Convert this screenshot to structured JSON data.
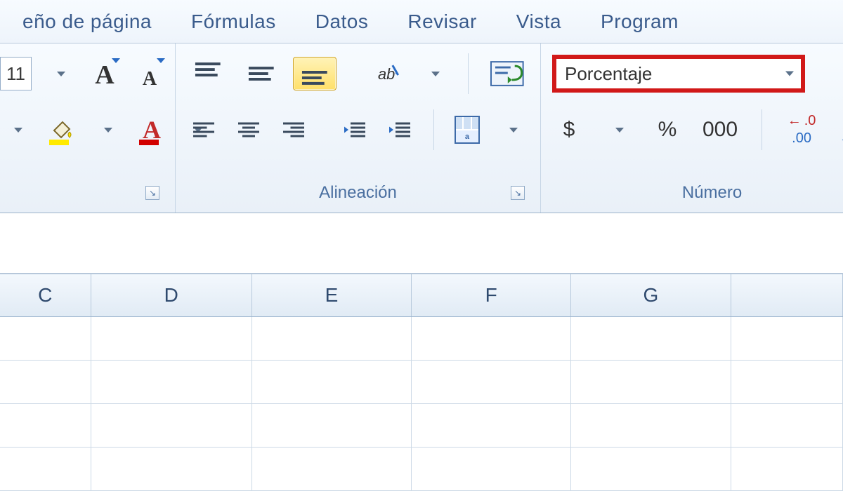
{
  "tabs": {
    "layout": "eño de página",
    "formulas": "Fórmulas",
    "data": "Datos",
    "review": "Revisar",
    "view": "Vista",
    "developer": "Program"
  },
  "font": {
    "size": "11"
  },
  "alignment": {
    "group_label": "Alineación"
  },
  "number": {
    "group_label": "Número",
    "format_selected": "Porcentaje",
    "currency_symbol": "$",
    "percent_symbol": "%",
    "thousands_symbol": "000"
  },
  "columns": {
    "C": "C",
    "D": "D",
    "E": "E",
    "F": "F",
    "G": "G"
  }
}
